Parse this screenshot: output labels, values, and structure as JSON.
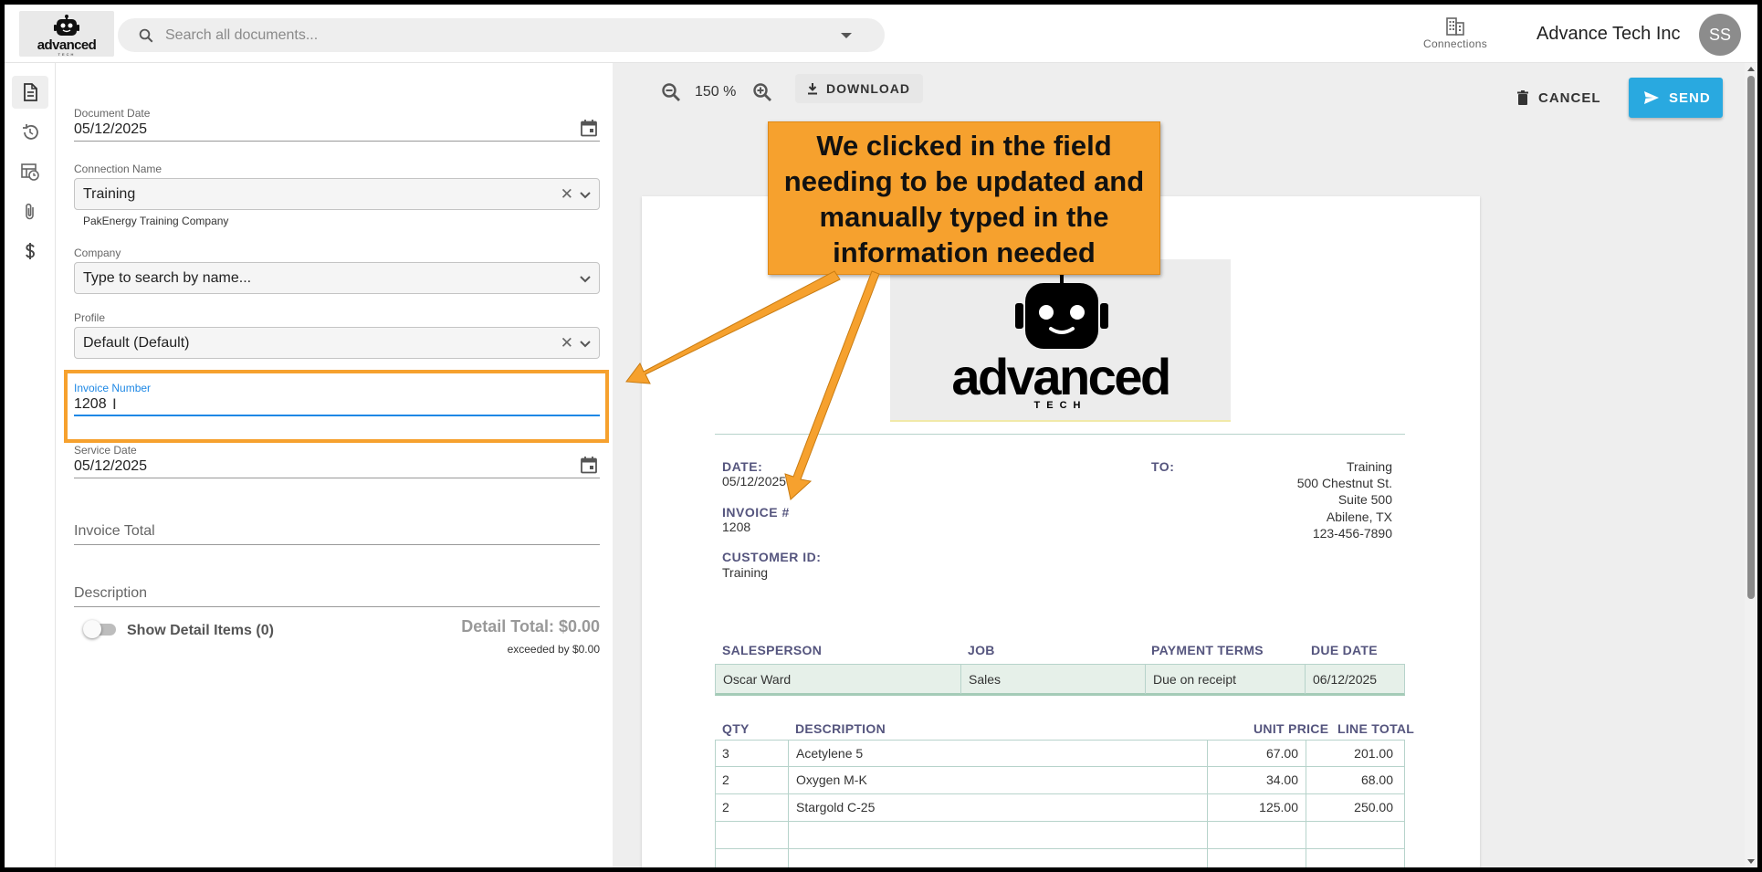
{
  "header": {
    "logo_text": "advanced",
    "logo_subtext": "TECH",
    "search_placeholder": "Search all documents...",
    "connections_label": "Connections",
    "company_name": "Advance Tech Inc",
    "avatar_initials": "SS"
  },
  "rail": {
    "items": [
      "document-icon",
      "history-icon",
      "table-clock-icon",
      "attachment-icon",
      "dollar-icon"
    ]
  },
  "form": {
    "document_date_label": "Document Date",
    "document_date": "05/12/2025",
    "connection_name_label": "Connection Name",
    "connection_name": "Training",
    "connection_helper": "PakEnergy Training Company",
    "company_label": "Company",
    "company_placeholder": "Type to search by name...",
    "profile_label": "Profile",
    "profile": "Default (Default)",
    "invoice_number_label": "Invoice Number",
    "invoice_number": "1208",
    "service_date_label": "Service Date",
    "service_date": "05/12/2025",
    "invoice_total_label": "Invoice Total",
    "description_label": "Description",
    "show_detail_label": "Show Detail Items (0)",
    "detail_total": "Detail Total: $0.00",
    "exceeded": "exceeded by $0.00"
  },
  "viewer": {
    "zoom": "150 %",
    "download_label": "DOWNLOAD",
    "cancel_label": "CANCEL",
    "send_label": "SEND"
  },
  "invoice": {
    "logo_word": "advanced",
    "logo_tech": "TECH",
    "date_label": "DATE:",
    "date": "05/12/2025",
    "invoice_label": "INVOICE #",
    "invoice_number": "1208",
    "customer_label": "CUSTOMER ID:",
    "customer_id": "Training",
    "to_label": "TO:",
    "to_lines": [
      "Training",
      "500 Chestnut St.",
      "Suite 500",
      "Abilene, TX",
      "123-456-7890"
    ],
    "sp_headers": [
      "SALESPERSON",
      "JOB",
      "PAYMENT TERMS",
      "DUE DATE"
    ],
    "sp_values": [
      "Oscar Ward",
      "Sales",
      "Due on receipt",
      "06/12/2025"
    ],
    "item_headers": [
      "QTY",
      "DESCRIPTION",
      "UNIT PRICE",
      "LINE TOTAL"
    ],
    "items": [
      {
        "qty": "3",
        "description": "Acetylene 5",
        "unit_price": "67.00",
        "line_total": "201.00"
      },
      {
        "qty": "2",
        "description": "Oxygen M-K",
        "unit_price": "34.00",
        "line_total": "68.00"
      },
      {
        "qty": "2",
        "description": "Stargold C-25",
        "unit_price": "125.00",
        "line_total": "250.00"
      },
      {
        "qty": "",
        "description": "",
        "unit_price": "",
        "line_total": ""
      },
      {
        "qty": "",
        "description": "",
        "unit_price": "",
        "line_total": ""
      }
    ]
  },
  "annotation": {
    "callout_lines": [
      "We clicked in the field",
      "needing to be updated and",
      "manually typed in the",
      "information needed"
    ],
    "color": "#f6a12e"
  },
  "colors": {
    "accent_blue": "#1e88e5",
    "send_button": "#29a9e0",
    "invoice_heading": "#55557e"
  }
}
